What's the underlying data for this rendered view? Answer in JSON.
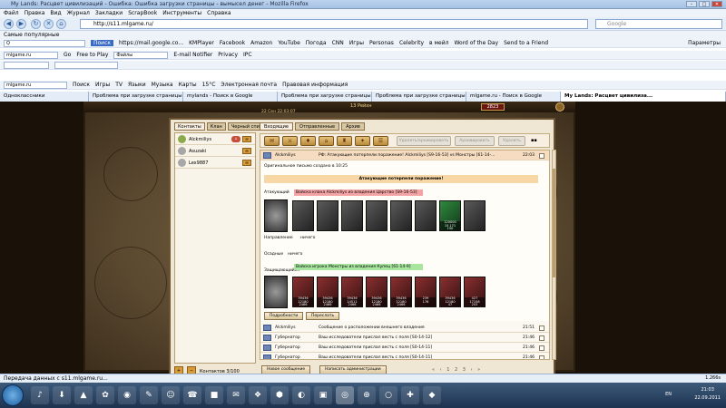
{
  "browser": {
    "title": "My Lands: Расцвет цивилизаций - Ошибка: Ошибка загрузки страницы - вымысел денег - Mozilla Firefox",
    "menu": [
      "Файл",
      "Правка",
      "Вид",
      "Журнал",
      "Закладки",
      "ScrapBook",
      "Инструменты",
      "Справка"
    ],
    "url": "http://s11.mlgame.ru/",
    "search_placeholder": "Google",
    "bookmarks_label": "Самые популярные",
    "toolbar1": {
      "search_btn": "Поиск",
      "gmail": "https://mail.google.co...",
      "items": [
        "KMPlayer",
        "Facebook",
        "Amazon",
        "YouTube",
        "Погода",
        "CNN",
        "Игры",
        "Personas",
        "Celebrity",
        "в мейл",
        "Word of the Day",
        "Send to a Friend"
      ],
      "right": "Параметры"
    },
    "toolbar2": {
      "field": "mlgame.ru",
      "go": "Go",
      "items": [
        "Free to Play",
        "Файлы",
        "E-mail Notifier",
        "Privacy",
        "IPC"
      ]
    },
    "toolbar3": {
      "field": "mlgame.ru",
      "items": [
        "Поиск",
        "Игры",
        "TV",
        "Языки",
        "Музыка",
        "Карты",
        "15°C",
        "Электронная почта",
        "Правовая информация"
      ]
    },
    "tabs": [
      "Одноклассники",
      "Проблема при загрузке страницы",
      "mylands - Поиск в Google",
      "Проблема при загрузке страницы",
      "Проблема при загрузке страницы",
      "mlgame.ru - Поиск в Google",
      "My Lands: Расцвет цивилиза..."
    ],
    "status": "Передача данных с s11.mlgame.ru...",
    "status_right": "1.266s"
  },
  "game": {
    "header_gold": "13 Рейхн",
    "header_rub": "2823",
    "header_date": "22 Сен 22:03:07",
    "left_tabs": [
      "Контакты",
      "Клан",
      "Черный спи"
    ],
    "contacts": [
      {
        "name": "Alckmiliys"
      },
      {
        "name": "Asuzaki"
      },
      {
        "name": "Lex9887"
      }
    ],
    "contacts_count": "Контактов 3/100",
    "right_tabs": [
      "Входящие",
      "Отправленные",
      "Архив"
    ],
    "gray_buttons": [
      "Удалить/архивировать",
      "Архивировать",
      "Удалить"
    ],
    "messages": {
      "open": {
        "from": "Alckmiliys",
        "subject": "РФ: Атакующие потерпели поражение! Alckmiliys [S9-16-53] vs Монстры [61-14-...",
        "time": "22:03"
      },
      "rows": [
        {
          "from": "Alckmiliys",
          "subject": "Сообщение о расположении внешнего владения",
          "time": "21:51"
        },
        {
          "from": "Губернатор",
          "subject": "Ваш исследователи прислал весть с поля [S0-14-12]",
          "time": "21:46"
        },
        {
          "from": "Губернатор",
          "subject": "Ваш исследователи прислал весть с поля [S0-14-11]",
          "time": "21:46"
        },
        {
          "from": "Губернатор",
          "subject": "Ваш исследователи прислал весть с поля [S0-14-11]",
          "time": "21:46"
        }
      ]
    },
    "report": {
      "created": "Оригинальное письмо создано в 10:25",
      "banner": "Атакующие потерпели поражение!",
      "attacker_label": "Атакующий",
      "attacker_text": "Войска клана Alckmiliys из владения Царство [S9-16-53]",
      "direction_label": "Направление",
      "direction_value": "ничего",
      "loot_label": "Осадные",
      "loot_value": "ничего",
      "defender_label": "Защищающийся",
      "defender_text": "Войска игрока Монстры из владения Купец [61-14-9]",
      "attacker_units": [
        {
          "a": "",
          "b": "",
          "c": ""
        },
        {
          "a": "",
          "b": "",
          "c": ""
        },
        {
          "a": "",
          "b": "",
          "c": ""
        },
        {
          "a": "",
          "b": "",
          "c": ""
        },
        {
          "a": "",
          "b": "",
          "c": ""
        },
        {
          "a": "",
          "b": "",
          "c": ""
        },
        {
          "a": "120000",
          "b": "15 171",
          "c": "150"
        },
        {
          "a": "",
          "b": "",
          "c": ""
        }
      ],
      "defender_units": [
        {
          "a": "",
          "b": "",
          "c": ""
        },
        {
          "a": "39436",
          "b": "12180",
          "c": "2466"
        },
        {
          "a": "39436",
          "b": "12180",
          "c": "2466"
        },
        {
          "a": "39436",
          "b": "14511",
          "c": "2466"
        },
        {
          "a": "39436",
          "b": "12180",
          "c": "2466"
        },
        {
          "a": "39436",
          "b": "12180",
          "c": "2466"
        },
        {
          "a": "239",
          "b": "",
          "c": "176"
        },
        {
          "a": "39436",
          "b": "12180",
          "c": "47"
        },
        {
          "a": "427",
          "b": "17158",
          "c": "203"
        }
      ],
      "details_btn": "Подробности",
      "forward_btn": "Переслать"
    },
    "footer": {
      "new_btn": "Новое сообщение",
      "admin_btn": "Написать администрации",
      "pages": "« ‹ 1 2 3 › »"
    }
  },
  "taskbar": {
    "lang": "EN",
    "time": "21:03",
    "date": "22.09.2011"
  }
}
